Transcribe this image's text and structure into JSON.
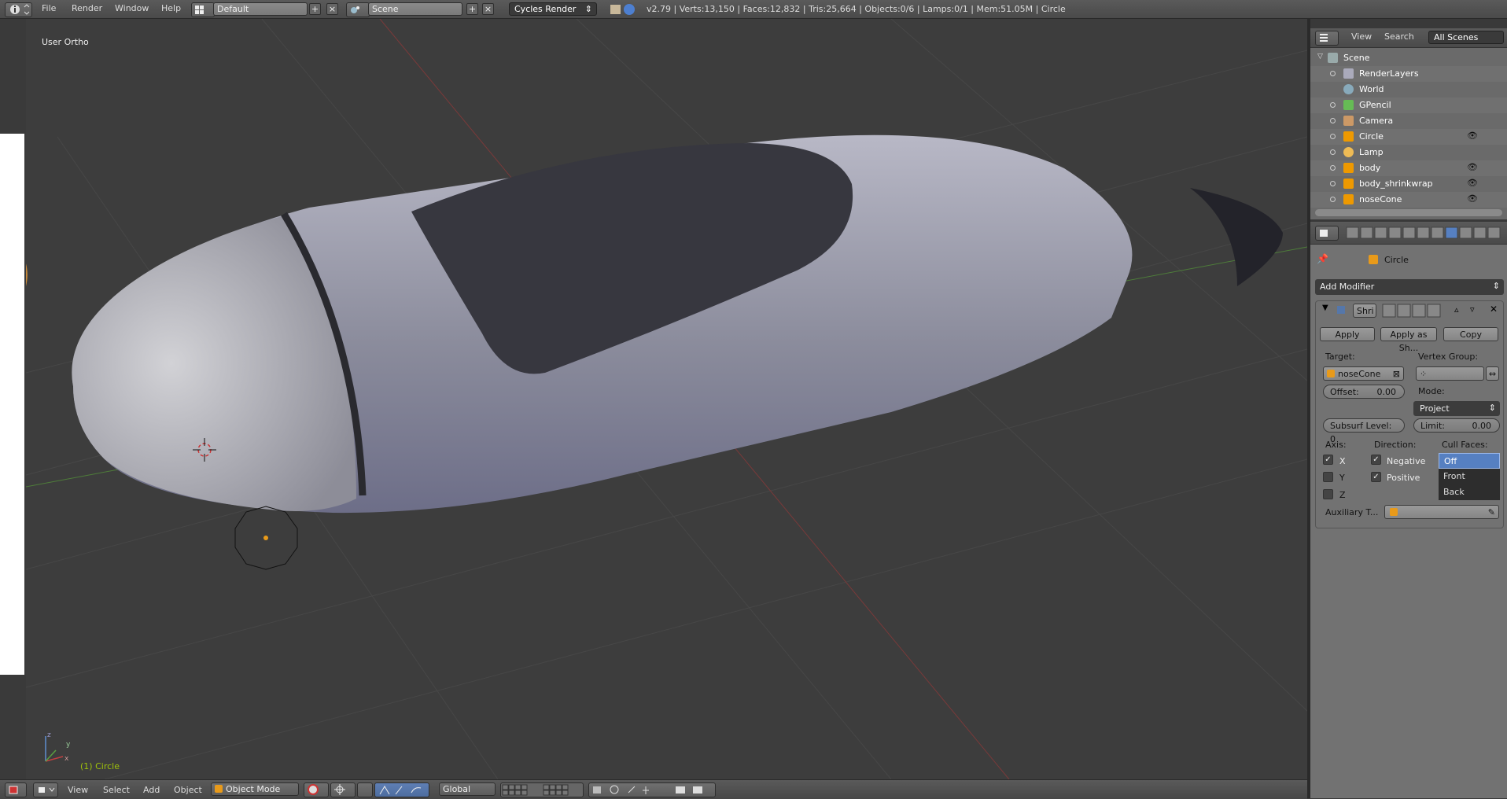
{
  "header": {
    "menus": [
      "File",
      "Render",
      "Window",
      "Help"
    ],
    "layout": "Default",
    "scene": "Scene",
    "engine": "Cycles Render",
    "stats": "v2.79 | Verts:13,150 | Faces:12,832 | Tris:25,664 | Objects:0/6 | Lamps:0/1 | Mem:51.05M | Circle"
  },
  "viewport": {
    "view_label": "User Ortho",
    "object_label": "(1) Circle",
    "axis_y": "y",
    "axis_x": "x",
    "axis_z": "z"
  },
  "footer": {
    "menus": [
      "View",
      "Select",
      "Add",
      "Object"
    ],
    "mode": "Object Mode",
    "orientation": "Global"
  },
  "outliner": {
    "menus": [
      "View",
      "Search"
    ],
    "filter": "All Scenes",
    "items": [
      {
        "name": "Scene",
        "icon": "scene-icon",
        "color": "#9aa"
      },
      {
        "name": "RenderLayers",
        "icon": "renderlayers-icon",
        "color": "#aab"
      },
      {
        "name": "World",
        "icon": "world-icon",
        "color": "#8ab"
      },
      {
        "name": "GPencil",
        "icon": "gpencil-icon",
        "color": "#6b5"
      },
      {
        "name": "Camera",
        "icon": "camera-icon",
        "color": "#c96"
      },
      {
        "name": "Circle",
        "icon": "mesh-icon",
        "color": "#e90"
      },
      {
        "name": "Lamp",
        "icon": "lamp-icon",
        "color": "#eb5"
      },
      {
        "name": "body",
        "icon": "mesh-icon",
        "color": "#e90"
      },
      {
        "name": "body_shrinkwrap",
        "icon": "mesh-icon",
        "color": "#e90"
      },
      {
        "name": "noseCone",
        "icon": "mesh-icon",
        "color": "#e90"
      }
    ]
  },
  "properties": {
    "context_object": "Circle",
    "add_modifier": "Add Modifier",
    "modifier_name": "Shri",
    "apply": "Apply",
    "apply_as_shape": "Apply as Sh...",
    "copy": "Copy",
    "target_label": "Target:",
    "target_value": "noseCone",
    "vertex_group_label": "Vertex Group:",
    "offset_label": "Offset:",
    "offset_value": "0.00",
    "mode_label": "Mode:",
    "mode_value": "Project",
    "subsurf_label": "Subsurf Level: 0",
    "limit_label": "Limit:",
    "limit_value": "0.00",
    "axis_label": "Axis:",
    "direction_label": "Direction:",
    "cull_label": "Cull Faces:",
    "axis_x": "X",
    "axis_y": "Y",
    "axis_z": "Z",
    "negative": "Negative",
    "positive": "Positive",
    "cull_options": [
      "Off",
      "Front",
      "Back"
    ],
    "auxiliary_label": "Auxiliary T..."
  },
  "colors": {
    "selection": "#5680c2",
    "object_label": "#9fc20a"
  }
}
